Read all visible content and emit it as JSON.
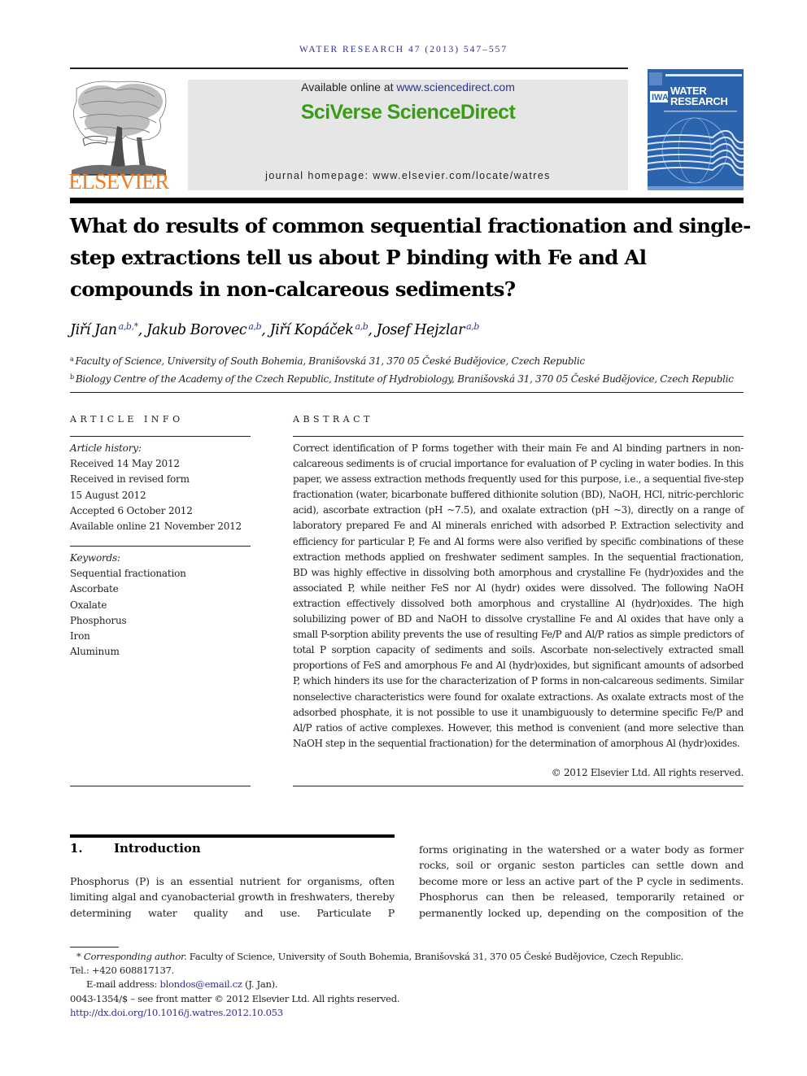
{
  "running_head": "WATER RESEARCH 47 (2013) 547–557",
  "publisher": {
    "name": "ELSEVIER",
    "logo_icon": "elsevier-tree-icon",
    "brand_color": "#f47b20"
  },
  "banner": {
    "available_prefix": "Available online at ",
    "available_link": "www.sciencedirect.com",
    "title": "SciVerse ScienceDirect",
    "title_color": "#3a9b17",
    "homepage_label": "journal homepage: www.elsevier.com/locate/watres"
  },
  "cover": {
    "line1": "WATER",
    "line2": "RESEARCH",
    "logo": "IWA",
    "color": "#2c63ad"
  },
  "article": {
    "title": "What do results of common sequential fractionation and single-step extractions tell us about P binding with Fe and Al compounds in non-calcareous sediments?",
    "authors": [
      {
        "name": "Jiří Jan",
        "sup": "a,b,*"
      },
      {
        "name": "Jakub Borovec",
        "sup": "a,b"
      },
      {
        "name": "Jiří Kopáček",
        "sup": "a,b"
      },
      {
        "name": "Josef Hejzlar",
        "sup": "a,b"
      }
    ],
    "affiliations": [
      {
        "key": "a",
        "text": "Faculty of Science, University of South Bohemia, Branišovská 31, 370 05 České Budějovice, Czech Republic"
      },
      {
        "key": "b",
        "text": "Biology Centre of the Academy of the Czech Republic, Institute of Hydrobiology, Branišovská 31, 370 05 České Budějovice, Czech Republic"
      }
    ]
  },
  "article_info": {
    "heading": "ARTICLE INFO",
    "history_label": "Article history:",
    "history": [
      "Received 14 May 2012",
      "Received in revised form",
      "15 August 2012",
      "Accepted 6 October 2012",
      "Available online 21 November 2012"
    ],
    "keywords_label": "Keywords:",
    "keywords": [
      "Sequential fractionation",
      "Ascorbate",
      "Oxalate",
      "Phosphorus",
      "Iron",
      "Aluminum"
    ]
  },
  "abstract": {
    "heading": "ABSTRACT",
    "text": "Correct identification of P forms together with their main Fe and Al binding partners in non-calcareous sediments is of crucial importance for evaluation of P cycling in water bodies. In this paper, we assess extraction methods frequently used for this purpose, i.e., a sequential five-step fractionation (water, bicarbonate buffered dithionite solution (BD), NaOH, HCl, nitric-perchloric acid), ascorbate extraction (pH ~7.5), and oxalate extraction (pH ~3), directly on a range of laboratory prepared Fe and Al minerals enriched with adsorbed P. Extraction selectivity and efficiency for particular P, Fe and Al forms were also verified by specific combinations of these extraction methods applied on freshwater sediment samples. In the sequential fractionation, BD was highly effective in dissolving both amor­phous and crystalline Fe (hydr)oxides and the associated P, while neither FeS nor Al (hydr) oxides were dissolved. The following NaOH extraction effectively dissolved both amorphous and crystalline Al (hydr)oxides. The high solubilizing power of BD and NaOH to dissolve crystalline Fe and Al oxides that have only a small P-sorption ability prevents the use of resulting Fe/P and Al/P ratios as simple predictors of total P sorption capacity of sediments and soils. Ascorbate non-selectively extracted small proportions of FeS and amorphous Fe and Al (hydr)oxides, but significant amounts of adsorbed P, which hinders its use for the characterization of P forms in non-calcareous sediments. Similar nonselective character­istics were found for oxalate extractions. As oxalate extracts most of the adsorbed phos­phate, it is not possible to use it unambiguously to determine specific Fe/P and Al/P ratios of active complexes. However, this method is convenient (and more selective than NaOH step in the sequential fractionation) for the determination of amorphous Al (hydr)oxides.",
    "copyright": "© 2012 Elsevier Ltd. All rights reserved."
  },
  "introduction": {
    "number": "1.",
    "heading": "Introduction",
    "left_text": "Phosphorus (P) is an essential nutrient for organisms, often limiting algal and cyanobacterial growth in freshwaters, thereby determining water quality and use. Particulate P",
    "right_text": "forms originating in the watershed or a water body as former rocks, soil or organic seston particles can settle down and become more or less an active part of the P cycle in sediments. Phosphorus can then be released, temporarily retained or permanently locked up, depending on the composition of the"
  },
  "footnotes": {
    "star": "*",
    "corr_label": "Corresponding author.",
    "corr_text": " Faculty of Science, University of South Bohemia, Branišovská 31, 370 05 České Budějovice, Czech Republic.",
    "tel": "Tel.: +420 608817137.",
    "email_label": "E-mail address: ",
    "email": "blondos@email.cz",
    "email_suffix": " (J. Jan).",
    "issn": "0043-1354/$ – see front matter © 2012 Elsevier Ltd. All rights reserved.",
    "doi": "http://dx.doi.org/10.1016/j.watres.2012.10.053"
  }
}
